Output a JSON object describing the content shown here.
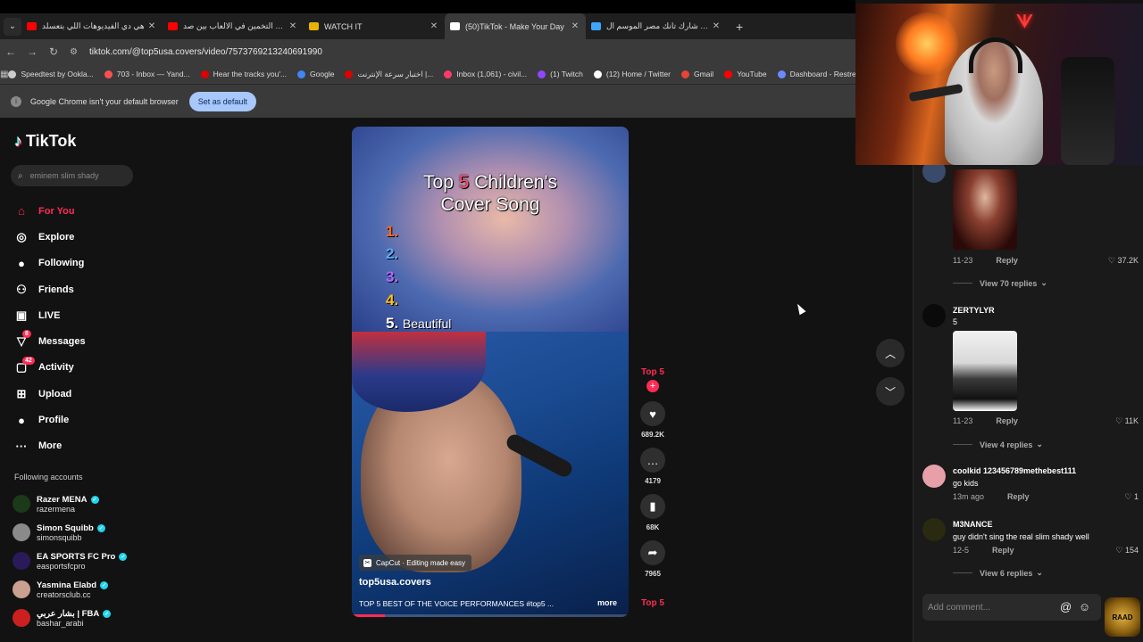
{
  "browser": {
    "tabs": [
      {
        "title": "هي دي الفيديوهات اللي بتعسلد",
        "color": "#ff0000",
        "active": false
      },
      {
        "title": "تحدي التخمين في الالعاب بين صد",
        "color": "#ff0000",
        "active": false
      },
      {
        "title": "WATCH IT",
        "color": "#e8b400",
        "active": false
      },
      {
        "title": "(50)TikTok - Make Your Day",
        "color": "#ffffff",
        "active": true
      },
      {
        "title": "برنامج شارك تانك مصر الموسم ال",
        "color": "#3ea6ff",
        "active": false
      }
    ],
    "url": "tiktok.com/@top5usa.covers/video/7573769213240691990",
    "bookmarks": [
      {
        "label": "Speedtest by Ookla...",
        "color": "#cccccc"
      },
      {
        "label": "703 - Inbox — Yand...",
        "color": "#ff5050"
      },
      {
        "label": "Hear the tracks you'...",
        "color": "#e00000"
      },
      {
        "label": "Google",
        "color": "#4285f4"
      },
      {
        "label": "اختبار سرعة الإنترنت |...",
        "color": "#e00000"
      },
      {
        "label": "Inbox (1,061) - civil...",
        "color": "#ff3a6a"
      },
      {
        "label": "(1) Twitch",
        "color": "#9146ff"
      },
      {
        "label": "(12) Home / Twitter",
        "color": "#ffffff"
      },
      {
        "label": "Gmail",
        "color": "#ea4335"
      },
      {
        "label": "YouTube",
        "color": "#ff0000"
      },
      {
        "label": "Dashboard - Restre...",
        "color": "#6a8aff"
      }
    ],
    "infobar_text": "Google Chrome isn't your default browser",
    "infobar_button": "Set as default"
  },
  "sidebar": {
    "logo": "TikTok",
    "search_placeholder": "eminem slim shady",
    "nav": [
      {
        "label": "For You",
        "icon": "home-icon",
        "glyph": "⌂",
        "active": true,
        "badge": ""
      },
      {
        "label": "Explore",
        "icon": "compass-icon",
        "glyph": "◎",
        "active": false,
        "badge": ""
      },
      {
        "label": "Following",
        "icon": "following-avatar-icon",
        "glyph": "●",
        "active": false,
        "badge": ""
      },
      {
        "label": "Friends",
        "icon": "friends-icon",
        "glyph": "⚇",
        "active": false,
        "badge": ""
      },
      {
        "label": "LIVE",
        "icon": "live-icon",
        "glyph": "▣",
        "active": false,
        "badge": ""
      },
      {
        "label": "Messages",
        "icon": "messages-icon",
        "glyph": "▽",
        "active": false,
        "badge": "8"
      },
      {
        "label": "Activity",
        "icon": "activity-icon",
        "glyph": "▢",
        "active": false,
        "badge": "42"
      },
      {
        "label": "Upload",
        "icon": "upload-icon",
        "glyph": "⊞",
        "active": false,
        "badge": ""
      },
      {
        "label": "Profile",
        "icon": "profile-avatar-icon",
        "glyph": "●",
        "active": false,
        "badge": ""
      },
      {
        "label": "More",
        "icon": "more-icon",
        "glyph": "···",
        "active": false,
        "badge": ""
      }
    ],
    "following_title": "Following accounts",
    "following": [
      {
        "name": "Razer MENA",
        "handle": "razermena",
        "color": "#1a3a1a"
      },
      {
        "name": "Simon Squibb",
        "handle": "simonsquibb",
        "color": "#8a8a8a"
      },
      {
        "name": "EA SPORTS FC Pro",
        "handle": "easportsfcpro",
        "color": "#2a1a5a"
      },
      {
        "name": "Yasmina Elabd",
        "handle": "creatorsclub.cc",
        "color": "#caa090"
      },
      {
        "name": "بشار عربي | FBA",
        "handle": "bashar_arabi",
        "color": "#cc2020"
      }
    ]
  },
  "video": {
    "title_pre": "Top ",
    "title_num": "5",
    "title_post": " Children's",
    "title_line2": "Cover Song",
    "ranks": [
      {
        "n": "1.",
        "color": "#ff6a1a",
        "text": ""
      },
      {
        "n": "2.",
        "color": "#5aa8ff",
        "text": ""
      },
      {
        "n": "3.",
        "color": "#b06aff",
        "text": ""
      },
      {
        "n": "4.",
        "color": "#ffc21a",
        "text": ""
      },
      {
        "n": "5.",
        "color": "#ffffff",
        "text": "Beautiful"
      }
    ],
    "capcut": "CapCut · Editing made easy",
    "author": "top5usa.covers",
    "description": "TOP 5 BEST OF THE VOICE PERFORMANCES #top5 ...",
    "more": "more",
    "progress": 0.12
  },
  "actions": {
    "author": "Top 5",
    "likes": "689.2K",
    "comments": "4179",
    "saves": "68K",
    "shares": "7965",
    "bottom_label": "Top 5"
  },
  "comments_panel": {
    "items": [
      {
        "kind": "image-meta",
        "date": "11-23",
        "reply": "Reply",
        "likes": "37.2K",
        "view": "View 70 replies"
      },
      {
        "kind": "comment",
        "user": "ZERTYLYR",
        "text": "5",
        "date": "11-23",
        "reply": "Reply",
        "likes": "11K",
        "view": "View 4 replies"
      },
      {
        "kind": "comment",
        "user": "coolkid 123456789methebest111",
        "text": "go kids",
        "date": "13m ago",
        "reply": "Reply",
        "likes": "1",
        "view": ""
      },
      {
        "kind": "comment",
        "user": "M3NANCE",
        "text": "guy didn't sing the real slim shady well",
        "date": "12-5",
        "reply": "Reply",
        "likes": "154",
        "view": "View 6 replies"
      }
    ],
    "input_placeholder": "Add comment...",
    "overlay_logo": "RAAD"
  }
}
